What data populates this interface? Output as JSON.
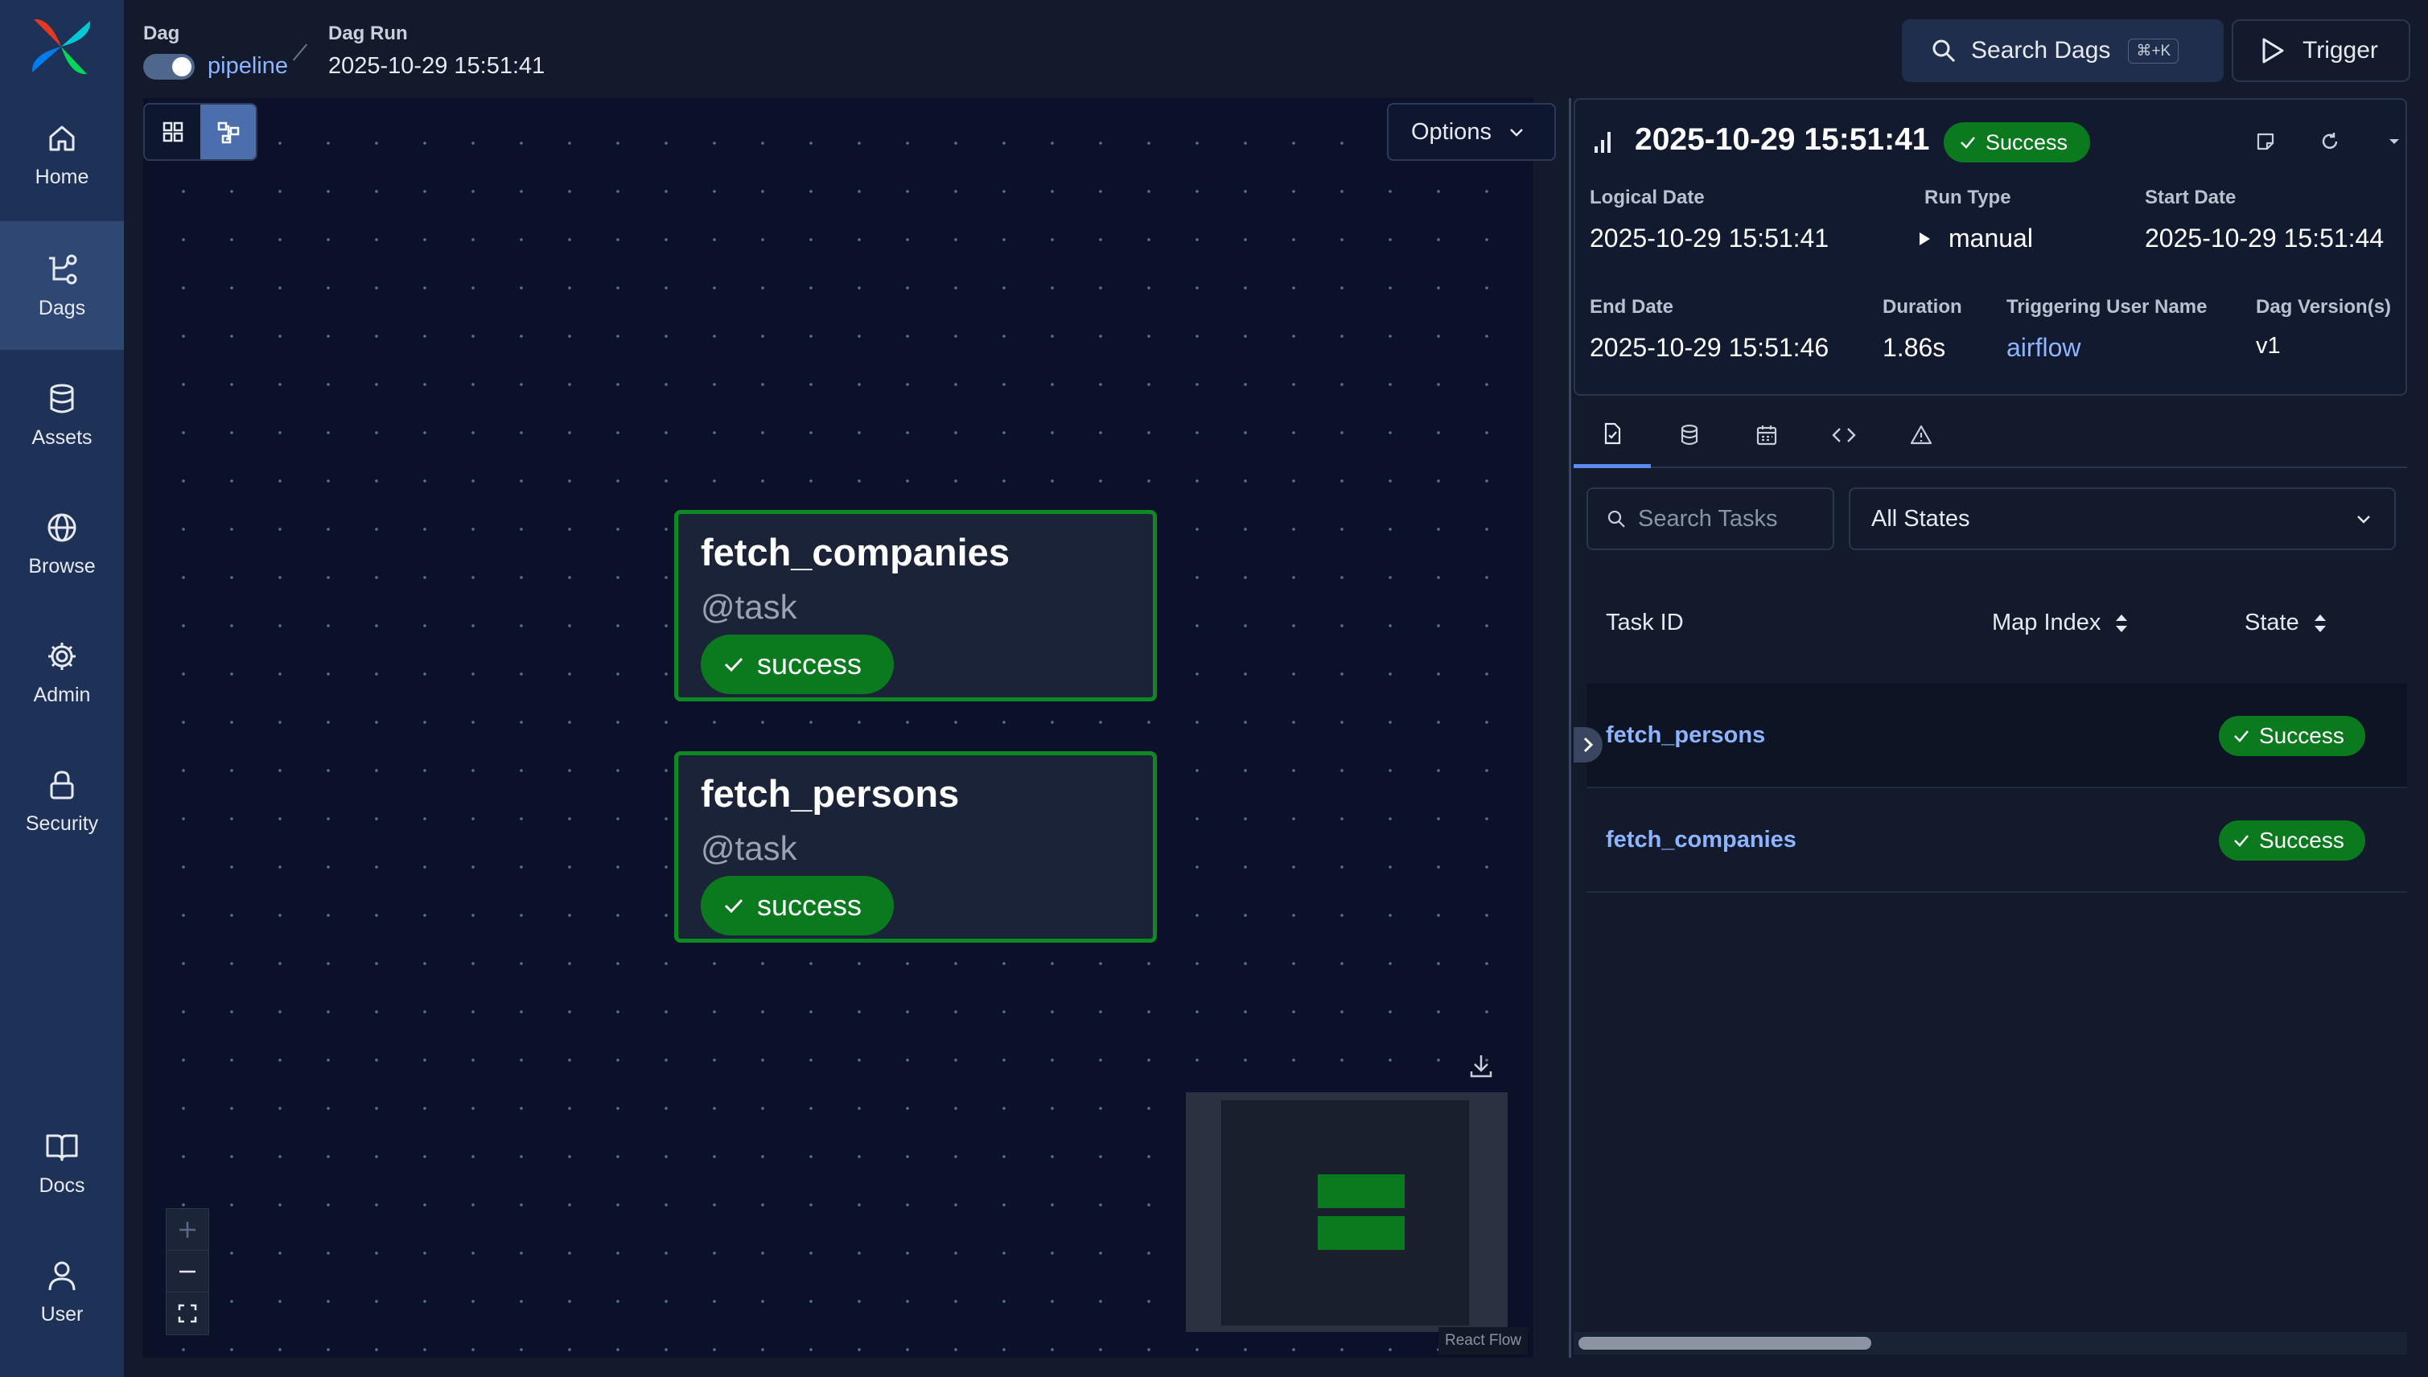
{
  "sidebar": {
    "items": [
      {
        "label": "Home",
        "icon": "home-icon",
        "active": false
      },
      {
        "label": "Dags",
        "icon": "dags-icon",
        "active": true
      },
      {
        "label": "Assets",
        "icon": "database-icon",
        "active": false
      },
      {
        "label": "Browse",
        "icon": "globe-icon",
        "active": false
      },
      {
        "label": "Admin",
        "icon": "gear-icon",
        "active": false
      },
      {
        "label": "Security",
        "icon": "lock-icon",
        "active": false
      }
    ],
    "bottom_items": [
      {
        "label": "Docs",
        "icon": "book-icon"
      },
      {
        "label": "User",
        "icon": "user-icon"
      }
    ]
  },
  "header": {
    "dag_label": "Dag",
    "dag_name": "pipeline",
    "dag_toggle_on": true,
    "run_label": "Dag Run",
    "run_id": "2025-10-29 15:51:41",
    "search_label": "Search Dags",
    "search_shortcut": "⌘+K",
    "trigger_label": "Trigger"
  },
  "graph": {
    "options_label": "Options",
    "view_modes": [
      "grid",
      "graph"
    ],
    "active_view": "graph",
    "nodes": [
      {
        "name": "fetch_companies",
        "type": "@task",
        "state": "success"
      },
      {
        "name": "fetch_persons",
        "type": "@task",
        "state": "success"
      }
    ],
    "attribution": "React Flow",
    "colors": {
      "success": "#0b7a1e",
      "node_border": "#0e8a23"
    }
  },
  "run_details": {
    "title": "2025-10-29 15:51:41",
    "status": "Success",
    "logical_date_label": "Logical Date",
    "logical_date": "2025-10-29 15:51:41",
    "run_type_label": "Run Type",
    "run_type": "manual",
    "start_date_label": "Start Date",
    "start_date": "2025-10-29 15:51:44",
    "end_date_label": "End Date",
    "end_date": "2025-10-29 15:51:46",
    "duration_label": "Duration",
    "duration": "1.86s",
    "triggering_user_label": "Triggering User Name",
    "triggering_user": "airflow",
    "dag_version_label": "Dag Version(s)",
    "dag_version": "v1"
  },
  "tabs": [
    {
      "icon": "task-instances-icon",
      "active": true
    },
    {
      "icon": "asset-events-icon",
      "active": false
    },
    {
      "icon": "audit-log-icon",
      "active": false
    },
    {
      "icon": "code-icon",
      "active": false
    },
    {
      "icon": "warning-icon",
      "active": false
    }
  ],
  "task_filter": {
    "search_placeholder": "Search Tasks",
    "state_select": "All States"
  },
  "task_table": {
    "columns": [
      "Task ID",
      "Map Index",
      "State"
    ],
    "rows": [
      {
        "task_id": "fetch_persons",
        "state": "Success"
      },
      {
        "task_id": "fetch_companies",
        "state": "Success"
      }
    ]
  }
}
